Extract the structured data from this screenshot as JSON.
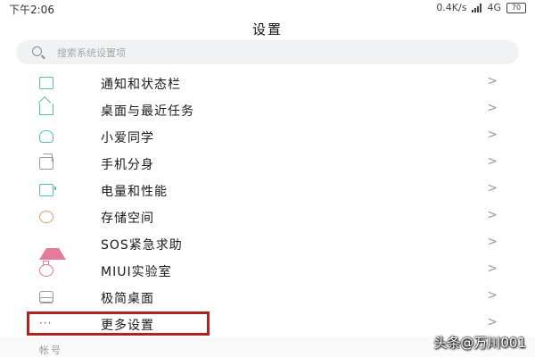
{
  "status_bar": {
    "time": "下午2:06",
    "network_speed": "0.4K/s",
    "network_type": "4G",
    "battery": "70"
  },
  "header": {
    "title": "设置"
  },
  "search": {
    "placeholder": "搜索系统设置项"
  },
  "settings_items": [
    {
      "label": "通知和状态栏",
      "icon": "notification-icon"
    },
    {
      "label": "桌面与最近任务",
      "icon": "home-icon"
    },
    {
      "label": "小爱同学",
      "icon": "xiaoai-icon"
    },
    {
      "label": "手机分身",
      "icon": "dual-phone-icon"
    },
    {
      "label": "电量和性能",
      "icon": "battery-icon"
    },
    {
      "label": "存储空间",
      "icon": "storage-icon"
    },
    {
      "label": "SOS紧急求助",
      "icon": "sos-warning-icon"
    },
    {
      "label": "MIUI实验室",
      "icon": "lab-flask-icon"
    },
    {
      "label": "极简桌面",
      "icon": "simple-desktop-icon"
    },
    {
      "label": "更多设置",
      "icon": "more-dots-icon",
      "icon_text": "···"
    }
  ],
  "chevron": ">",
  "account_section": {
    "label": "帐号"
  },
  "watermark": "头条@万川001",
  "colors": {
    "accent": "#55c2a4",
    "highlight_border": "#b02222"
  }
}
